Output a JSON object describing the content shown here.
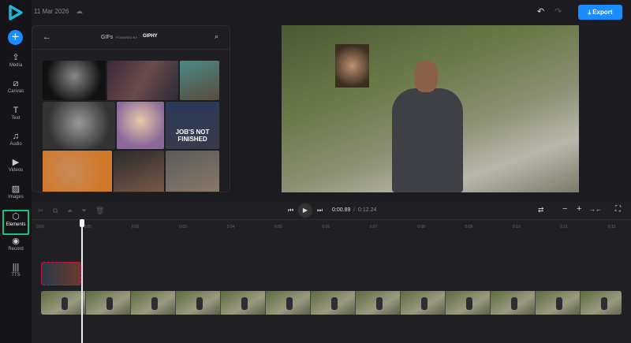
{
  "header": {
    "date": "11 Mar 2026",
    "export_label": "Export",
    "accent": "#1a8cff"
  },
  "sidebar": {
    "items": [
      {
        "label": "Media",
        "icon": "upload-cloud-icon"
      },
      {
        "label": "Canvas",
        "icon": "canvas-icon"
      },
      {
        "label": "Text",
        "icon": "text-icon"
      },
      {
        "label": "Audio",
        "icon": "music-note-icon"
      },
      {
        "label": "Videos",
        "icon": "video-icon"
      },
      {
        "label": "Images",
        "icon": "image-icon"
      },
      {
        "label": "Elements",
        "icon": "shapes-icon",
        "active": true
      },
      {
        "label": "Record",
        "icon": "record-icon"
      },
      {
        "label": "TTS",
        "icon": "waveform-icon"
      }
    ]
  },
  "gif_panel": {
    "title": "GIFs",
    "powered_by": "POWERED BY",
    "brand": "GIPHY",
    "gif_caption": "JOB'S NOT FINISHED"
  },
  "player": {
    "current_time": "0:00.89",
    "separator": "/",
    "total_time": "0:12.24"
  },
  "ruler": [
    "0:00",
    "0:01",
    "0:02",
    "0:03",
    "0:04",
    "0:05",
    "0:06",
    "0:07",
    "0:08",
    "0:09",
    "0:10",
    "0:11",
    "0:12"
  ]
}
